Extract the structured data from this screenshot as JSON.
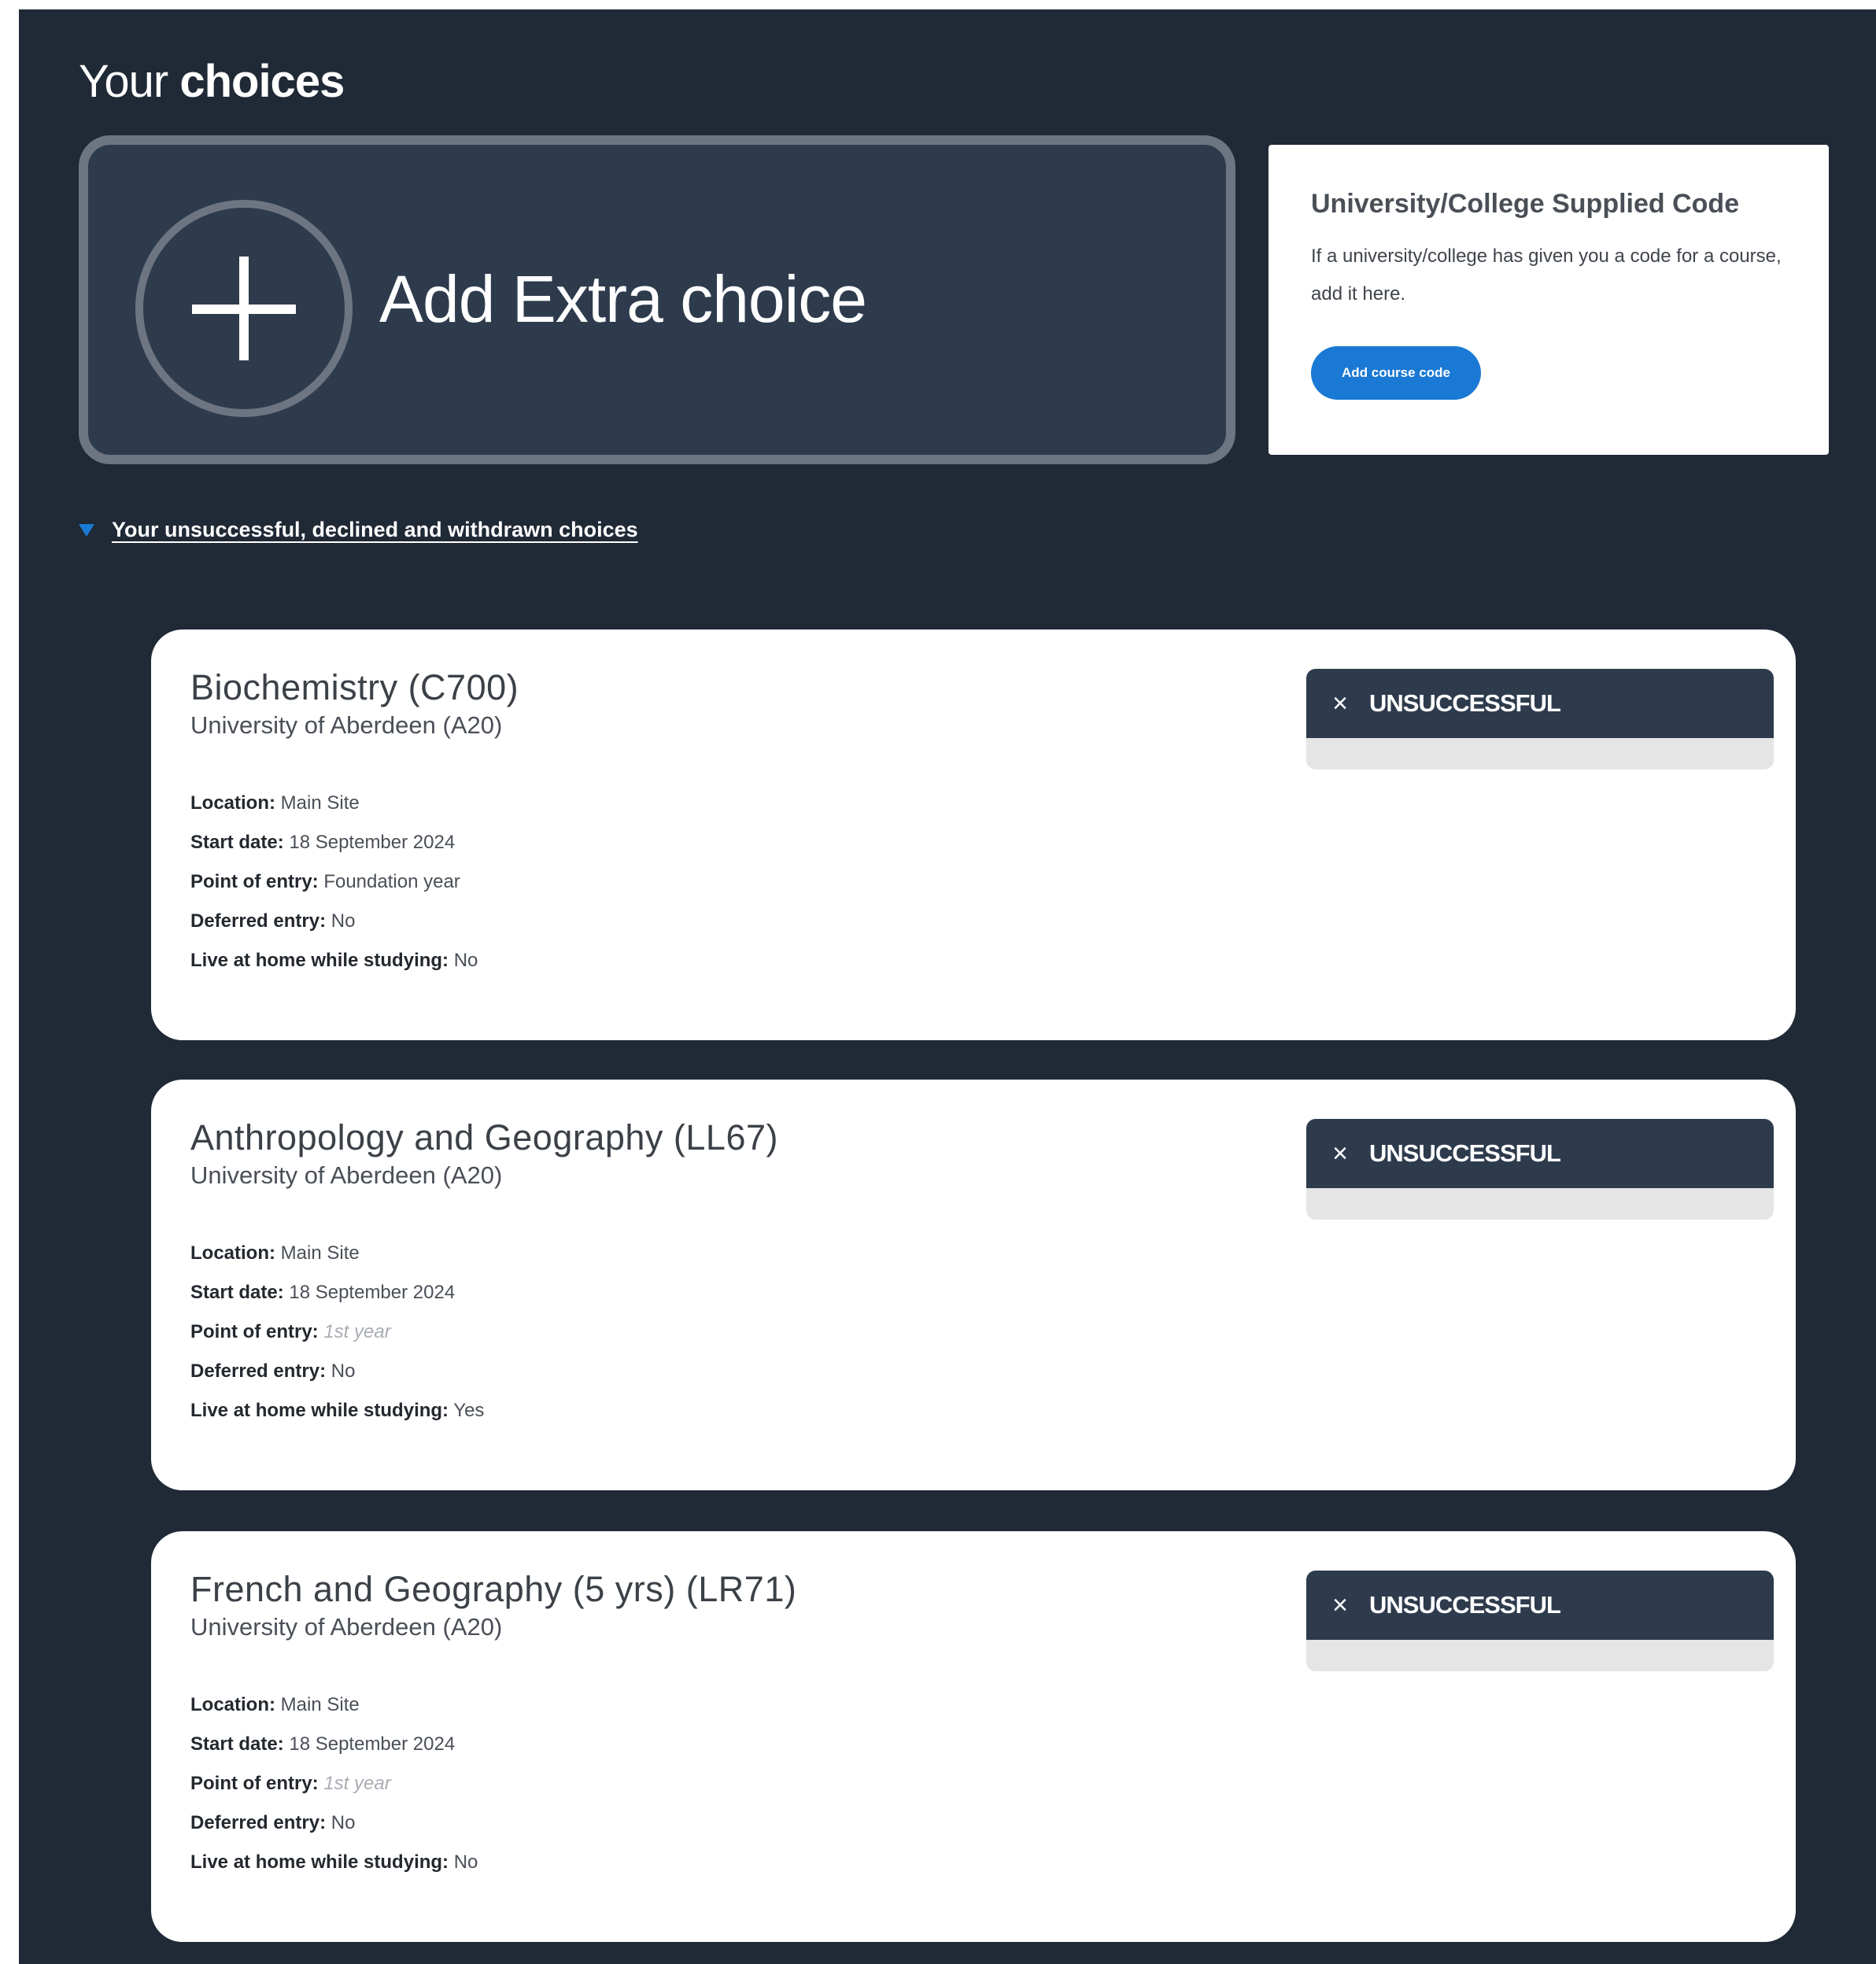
{
  "header": {
    "title_light": "Your",
    "title_bold": "choices"
  },
  "add_extra": {
    "label": "Add Extra choice",
    "icon": "plus-circle-icon"
  },
  "code_box": {
    "title": "University/College Supplied Code",
    "description": "If a university/college has given you a code for a course, add it here.",
    "button_label": "Add course code"
  },
  "disclosure": {
    "label": "Your unsuccessful, declined and withdrawn choices",
    "icon": "triangle-down-icon"
  },
  "colors": {
    "background": "#202936",
    "card_dark": "#2e3b4d",
    "accent_blue": "#1a79d4"
  },
  "choices": [
    {
      "title": "Biochemistry (C700)",
      "university": "University of Aberdeen (A20)",
      "status": "UNSUCCESSFUL",
      "location_label": "Location:",
      "location": "Main Site",
      "start_label": "Start date:",
      "start": "18 September 2024",
      "entry_label": "Point of entry:",
      "entry": "Foundation year",
      "deferred_label": "Deferred entry:",
      "deferred": "No",
      "home_label": "Live at home while studying:",
      "home": "No"
    },
    {
      "title": "Anthropology and Geography (LL67)",
      "university": "University of Aberdeen (A20)",
      "status": "UNSUCCESSFUL",
      "location_label": "Location:",
      "location": "Main Site",
      "start_label": "Start date:",
      "start": "18 September 2024",
      "entry_label": "Point of entry:",
      "entry": "1st year",
      "deferred_label": "Deferred entry:",
      "deferred": "No",
      "home_label": "Live at home while studying:",
      "home": "Yes"
    },
    {
      "title": "French and Geography (5 yrs) (LR71)",
      "university": "University of Aberdeen (A20)",
      "status": "UNSUCCESSFUL",
      "location_label": "Location:",
      "location": "Main Site",
      "start_label": "Start date:",
      "start": "18 September 2024",
      "entry_label": "Point of entry:",
      "entry": "1st year",
      "deferred_label": "Deferred entry:",
      "deferred": "No",
      "home_label": "Live at home while studying:",
      "home": "No"
    }
  ]
}
